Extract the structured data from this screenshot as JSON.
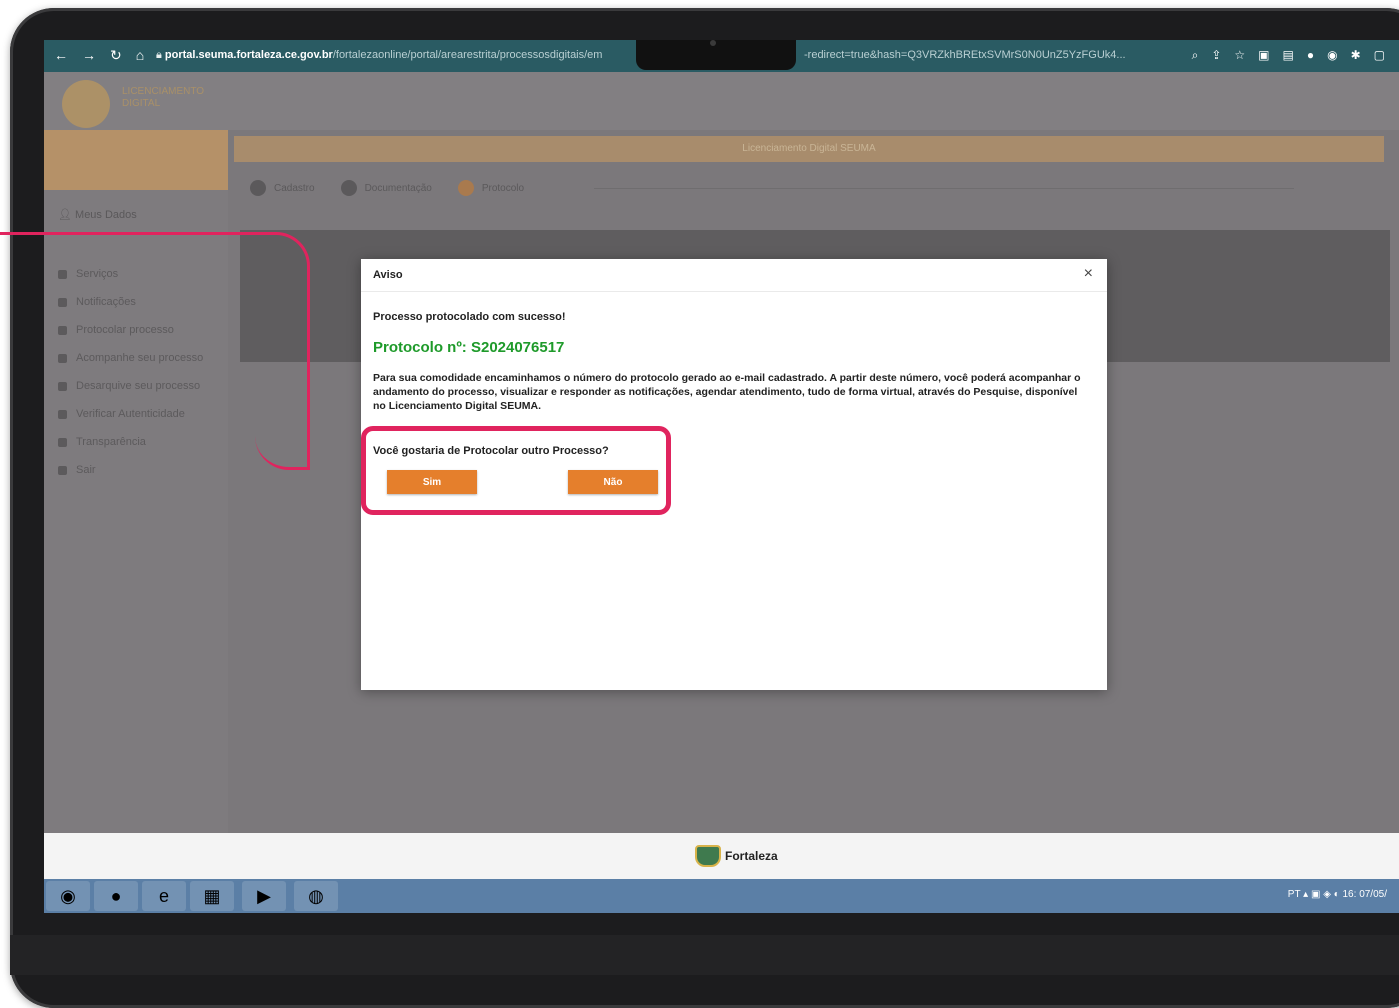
{
  "browser": {
    "url_host": "portal.seuma.fortaleza.ce.gov.br",
    "url_path": "/fortalezaonline/portal/arearestrita/processosdigitais/em",
    "url_tail": "-redirect=true&hash=Q3VRZkhBREtxSVMrS0N0UnZ5YzFGUk4..."
  },
  "page": {
    "logo_text_line1": "LICENCIAMENTO",
    "logo_text_line2": "DIGITAL",
    "banner": "Licenciamento Digital SEUMA",
    "sidebar": {
      "user": "Meus Dados",
      "items": [
        {
          "label": "Serviços"
        },
        {
          "label": "Notificações"
        },
        {
          "label": "Protocolar processo"
        },
        {
          "label": "Acompanhe seu processo"
        },
        {
          "label": "Desarquive seu processo"
        },
        {
          "label": "Verificar Autenticidade"
        },
        {
          "label": "Transparência"
        },
        {
          "label": "Sair"
        }
      ]
    },
    "steps": [
      {
        "label": "Cadastro"
      },
      {
        "label": "Documentação"
      },
      {
        "label": "Protocolo"
      }
    ]
  },
  "modal": {
    "title": "Aviso",
    "close_label": "×",
    "success_message": "Processo protocolado com sucesso!",
    "protocol_label": "Protocolo nº: S2024076517",
    "description": "Para sua comodidade encaminhamos o número do protocolo gerado ao e-mail cadastrado. A partir deste número, você poderá acompanhar o andamento do processo, visualizar e responder as notificações, agendar atendimento, tudo de forma virtual, através do Pesquise, disponível no Licenciamento Digital SEUMA.",
    "question": "Você gostaria de Protocolar outro Processo?",
    "yes_button": "Sim",
    "no_button": "Não"
  },
  "footer": {
    "brand": "Fortaleza"
  },
  "taskbar": {
    "tray_lang": "PT",
    "clock": "16:",
    "date": "07/05/"
  },
  "colors": {
    "accent_orange": "#e57f2c",
    "protocol_green": "#1e9a2a",
    "highlight_pink": "#e0245e"
  }
}
